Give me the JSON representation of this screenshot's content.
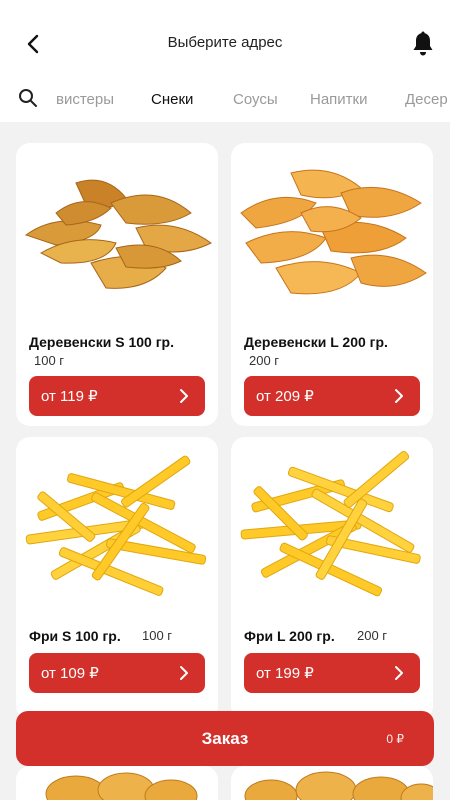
{
  "header": {
    "title": "Выберите адрес",
    "back_icon": "chevron-left-icon",
    "notification_icon": "bell-icon"
  },
  "tabs": {
    "search_icon": "search-icon",
    "items": [
      {
        "label": "вистеры",
        "active": false
      },
      {
        "label": "Снеки",
        "active": true
      },
      {
        "label": "Соусы",
        "active": false
      },
      {
        "label": "Напитки",
        "active": false
      },
      {
        "label": "Десер",
        "active": false
      }
    ]
  },
  "products": [
    {
      "name": "Деревенски S 100 гр.",
      "weight": "100 г",
      "price": "от 119 ₽",
      "image": "potato-wedges"
    },
    {
      "name": "Деревенски L 200 гр.",
      "weight": "200 г",
      "price": "от 209 ₽",
      "image": "potato-wedges"
    },
    {
      "name": "Фри S 100 гр.",
      "weight": "100 г",
      "price": "от 109 ₽",
      "image": "french-fries"
    },
    {
      "name": "Фри L 200 гр.",
      "weight": "200 г",
      "price": "от 199 ₽",
      "image": "french-fries"
    }
  ],
  "order": {
    "label": "Заказ",
    "total": "0 ₽"
  },
  "colors": {
    "accent": "#d4302b",
    "background": "#f2f2f2",
    "card": "#ffffff"
  }
}
